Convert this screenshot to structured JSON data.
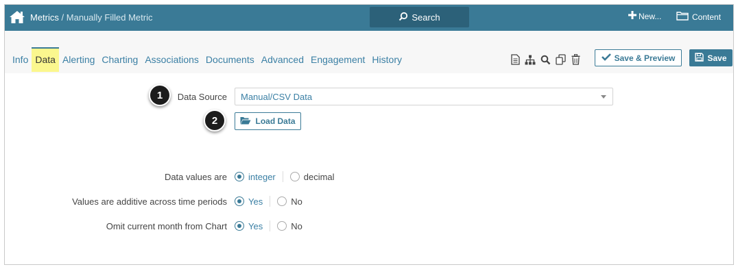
{
  "header": {
    "breadcrumb_root": "Metrics",
    "breadcrumb_sep": "/",
    "breadcrumb_current": "Manually Filled Metric",
    "search_label": "Search",
    "new_label": "New...",
    "content_label": "Content"
  },
  "tabs": [
    {
      "label": "Info"
    },
    {
      "label": "Data"
    },
    {
      "label": "Alerting"
    },
    {
      "label": "Charting"
    },
    {
      "label": "Associations"
    },
    {
      "label": "Documents"
    },
    {
      "label": "Advanced"
    },
    {
      "label": "Engagement"
    },
    {
      "label": "History"
    }
  ],
  "active_tab": "Data",
  "toolbar": {
    "icons": [
      "document-icon",
      "hierarchy-icon",
      "search-icon",
      "copy-icon",
      "trash-icon"
    ],
    "save_preview_label": "Save & Preview",
    "save_label": "Save"
  },
  "form": {
    "data_source_label": "Data Source",
    "data_source_value": "Manual/CSV Data",
    "load_data_label": "Load Data",
    "data_values_label": "Data values are",
    "data_values_options": [
      "integer",
      "decimal"
    ],
    "data_values_selected": "integer",
    "additive_label": "Values are additive across time periods",
    "additive_options": [
      "Yes",
      "No"
    ],
    "additive_selected": "Yes",
    "omit_label": "Omit current month from Chart",
    "omit_options": [
      "Yes",
      "No"
    ],
    "omit_selected": "Yes"
  },
  "callouts": {
    "one": "1",
    "two": "2"
  },
  "colors": {
    "primary": "#3a7a96",
    "link": "#3a7fa4",
    "active_tab_highlight": "#fbf78e"
  }
}
